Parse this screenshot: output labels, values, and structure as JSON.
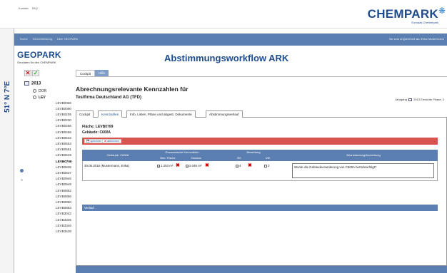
{
  "toplinks": [
    "Kontakt",
    "FAQ"
  ],
  "brand": {
    "name": "CHEMPARK",
    "sub": "Europas Chemiepark"
  },
  "coordinate": "51° N 7°E",
  "nav": {
    "items": [
      "Home",
      "Serviceleistung",
      "Über GEOPARK"
    ],
    "user": "Sie sind angemeldet als: Erika Mustermann"
  },
  "app": {
    "brand": "GEOPARK",
    "brand_sub": "Geodaten für den CHEMPARK",
    "title": "Abstimmungsworkflow ARK"
  },
  "top_tabs": [
    "Cockpit",
    "Hilfe"
  ],
  "tree": {
    "root": "2013",
    "nodes": [
      "DOR",
      "LEV"
    ],
    "leaves": [
      "LEVB0066",
      "LEVB0090",
      "LEVB0205",
      "LEVB0230",
      "LEVB0256",
      "LEVB0456",
      "LEVB0532",
      "LEVB0553",
      "LEVB0581",
      "LEVB0649",
      "LEVB0709",
      "LEVB0835",
      "LEVB0837",
      "LEVB0946",
      "LEVB0949",
      "LEVB0852",
      "LEVB0856",
      "LEVB0880",
      "LEVB0883",
      "LEVB3042",
      "LEVB3335",
      "LEVB3346",
      "LEVB3428"
    ],
    "active_leaf": "LEVB0709"
  },
  "main": {
    "title": "Abrechnungsrelevante Kennzahlen für",
    "company": "Testfirma Deutschland AG (TFD)",
    "jahrgang_label": "Jahrgang",
    "jahrgang_year": "2013",
    "phase": "Erreichte Phase: 2",
    "subtabs": [
      "Cockpit",
      "Kennzahlen",
      "Info, Listen, Pläne und abgest. Dokumente",
      "Abstimmungsverlauf"
    ],
    "active_subtab": "Kennzahlen",
    "flaeche": "Fläche: LEVB0709",
    "gebaeude": "Gebäude: C600A",
    "save": "speichern",
    "cancel": "abbrechen"
  },
  "grid": {
    "h_gebaeude": "Gebäude: C600A",
    "h_geo": "Geometrische Kennzahlen",
    "h_bew": "Bewertung",
    "h_beanst": "Beanstandung/Anmerkung",
    "sub_bebaut": "Beb. Fläche",
    "sub_nutzbar": "Nutzbar",
    "sub_bs": "BS",
    "sub_uw": "UW",
    "row": {
      "date_user": "30.05.2016 (Mustermann, Erika)",
      "bebaut": "1.253 m²",
      "nutzbar": "2.049 m²",
      "bs": "4",
      "uw": "2",
      "comment": "Wurde die Gebäudeerweiterung von C600A berücksichtigt?"
    }
  },
  "verlauf": "Verlauf"
}
